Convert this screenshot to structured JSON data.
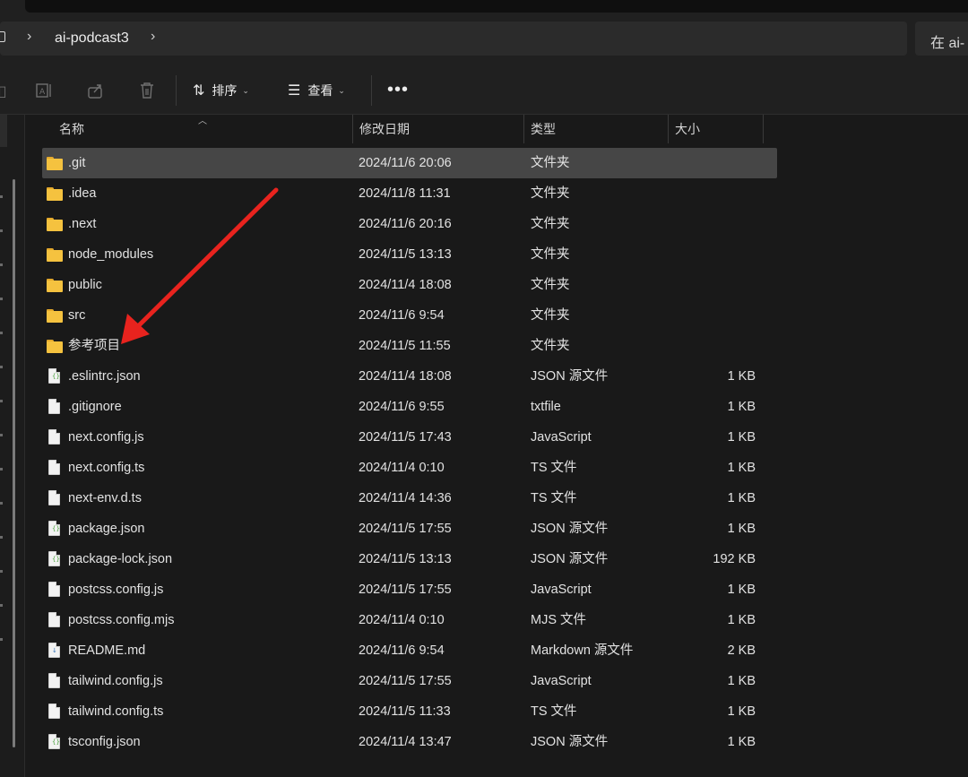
{
  "breadcrumb": {
    "current_folder": "ai-podcast3"
  },
  "search": {
    "placeholder": "在 ai-"
  },
  "toolbar": {
    "sort_label": "排序",
    "view_label": "查看",
    "more_label": "•••"
  },
  "columns": {
    "name": "名称",
    "date": "修改日期",
    "type": "类型",
    "size": "大小"
  },
  "files": [
    {
      "name": ".git",
      "date": "2024/11/6 20:06",
      "type": "文件夹",
      "size": "",
      "kind": "folder",
      "selected": true
    },
    {
      "name": ".idea",
      "date": "2024/11/8 11:31",
      "type": "文件夹",
      "size": "",
      "kind": "folder"
    },
    {
      "name": ".next",
      "date": "2024/11/6 20:16",
      "type": "文件夹",
      "size": "",
      "kind": "folder"
    },
    {
      "name": "node_modules",
      "date": "2024/11/5 13:13",
      "type": "文件夹",
      "size": "",
      "kind": "folder"
    },
    {
      "name": "public",
      "date": "2024/11/4 18:08",
      "type": "文件夹",
      "size": "",
      "kind": "folder"
    },
    {
      "name": "src",
      "date": "2024/11/6 9:54",
      "type": "文件夹",
      "size": "",
      "kind": "folder"
    },
    {
      "name": "参考项目",
      "date": "2024/11/5 11:55",
      "type": "文件夹",
      "size": "",
      "kind": "folder"
    },
    {
      "name": ".eslintrc.json",
      "date": "2024/11/4 18:08",
      "type": "JSON 源文件",
      "size": "1 KB",
      "kind": "json"
    },
    {
      "name": ".gitignore",
      "date": "2024/11/6 9:55",
      "type": "txtfile",
      "size": "1 KB",
      "kind": "file"
    },
    {
      "name": "next.config.js",
      "date": "2024/11/5 17:43",
      "type": "JavaScript",
      "size": "1 KB",
      "kind": "file"
    },
    {
      "name": "next.config.ts",
      "date": "2024/11/4 0:10",
      "type": "TS 文件",
      "size": "1 KB",
      "kind": "file"
    },
    {
      "name": "next-env.d.ts",
      "date": "2024/11/4 14:36",
      "type": "TS 文件",
      "size": "1 KB",
      "kind": "file"
    },
    {
      "name": "package.json",
      "date": "2024/11/5 17:55",
      "type": "JSON 源文件",
      "size": "1 KB",
      "kind": "json"
    },
    {
      "name": "package-lock.json",
      "date": "2024/11/5 13:13",
      "type": "JSON 源文件",
      "size": "192 KB",
      "kind": "json"
    },
    {
      "name": "postcss.config.js",
      "date": "2024/11/5 17:55",
      "type": "JavaScript",
      "size": "1 KB",
      "kind": "file"
    },
    {
      "name": "postcss.config.mjs",
      "date": "2024/11/4 0:10",
      "type": "MJS 文件",
      "size": "1 KB",
      "kind": "file"
    },
    {
      "name": "README.md",
      "date": "2024/11/6 9:54",
      "type": "Markdown 源文件",
      "size": "2 KB",
      "kind": "md"
    },
    {
      "name": "tailwind.config.js",
      "date": "2024/11/5 17:55",
      "type": "JavaScript",
      "size": "1 KB",
      "kind": "file"
    },
    {
      "name": "tailwind.config.ts",
      "date": "2024/11/5 11:33",
      "type": "TS 文件",
      "size": "1 KB",
      "kind": "file"
    },
    {
      "name": "tsconfig.json",
      "date": "2024/11/4 13:47",
      "type": "JSON 源文件",
      "size": "1 KB",
      "kind": "json"
    }
  ],
  "annotation": {
    "color": "#e8231e",
    "icon": "red-arrow-icon"
  }
}
